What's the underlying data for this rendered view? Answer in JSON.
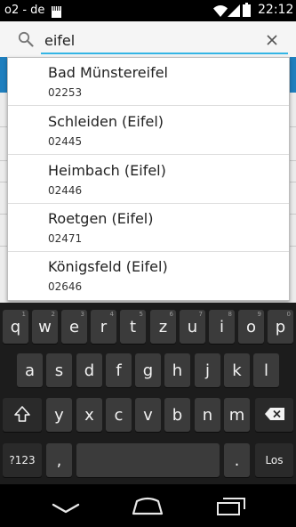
{
  "status_bar": {
    "carrier": "o2 - de",
    "time": "22:12"
  },
  "search": {
    "query": "eifel"
  },
  "suggestions": [
    {
      "name": "Bad Münstereifel",
      "code": "02253"
    },
    {
      "name": "Schleiden (Eifel)",
      "code": "02445"
    },
    {
      "name": "Heimbach (Eifel)",
      "code": "02446"
    },
    {
      "name": "Roetgen (Eifel)",
      "code": "02471"
    },
    {
      "name": "Königsfeld (Eifel)",
      "code": "02646"
    }
  ],
  "keyboard": {
    "row1": [
      {
        "label": "q",
        "hint": "1"
      },
      {
        "label": "w",
        "hint": "2"
      },
      {
        "label": "e",
        "hint": "3"
      },
      {
        "label": "r",
        "hint": "4"
      },
      {
        "label": "t",
        "hint": "5"
      },
      {
        "label": "z",
        "hint": "6"
      },
      {
        "label": "u",
        "hint": "7"
      },
      {
        "label": "i",
        "hint": "8"
      },
      {
        "label": "o",
        "hint": "9"
      },
      {
        "label": "p",
        "hint": "0"
      }
    ],
    "row2": [
      "a",
      "s",
      "d",
      "f",
      "g",
      "h",
      "j",
      "k",
      "l"
    ],
    "row3": [
      "y",
      "x",
      "c",
      "v",
      "b",
      "n",
      "m"
    ],
    "symbols_key": "?123",
    "comma_key": ",",
    "period_key": ".",
    "enter_key": "Los",
    "shift_icon": "shift-arrow-icon",
    "backspace_icon": "backspace-icon"
  },
  "colors": {
    "search_underline": "#33b5e5",
    "app_bar_blue": "#1f7fbe",
    "keyboard_bg": "#1c1c1c",
    "key_bg": "#3b3b3b"
  },
  "nav_bar": {
    "icons": [
      "back-icon",
      "home-icon",
      "recents-icon"
    ]
  }
}
